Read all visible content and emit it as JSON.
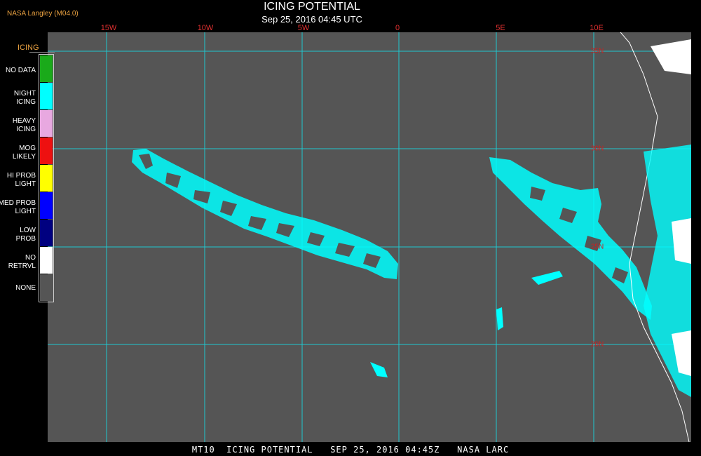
{
  "provider": "NASA Langley (M04.0)",
  "title": "ICING POTENTIAL",
  "subtitle": "Sep 25, 2016 04:45 UTC",
  "footer": "MT10  ICING POTENTIAL   SEP 25, 2016 04:45Z   NASA LARC",
  "longitude_labels": [
    "15W",
    "10W",
    "5W",
    "0",
    "5E",
    "10E"
  ],
  "latitude_labels": [
    "35N",
    "30N",
    "25N",
    "20N"
  ],
  "legend": {
    "title": "ICING",
    "items": [
      {
        "label": "NO DATA",
        "color": "#1aaa1a"
      },
      {
        "label": "NIGHT\nICING",
        "color": "#00ffff"
      },
      {
        "label": "HEAVY\nICING",
        "color": "#e8a8e0"
      },
      {
        "label": "MOG\nLIKELY",
        "color": "#ee1010"
      },
      {
        "label": "HI PROB\nLIGHT",
        "color": "#ffff00"
      },
      {
        "label": "MED PROB\nLIGHT",
        "color": "#0000ff"
      },
      {
        "label": "LOW\nPROB",
        "color": "#000080"
      },
      {
        "label": "NO\nRETRVL",
        "color": "#ffffff"
      },
      {
        "label": "NONE",
        "color": "#555555"
      }
    ]
  },
  "colors": {
    "background": "#555555",
    "grid": "#20c8d0",
    "icing": "#00ffff",
    "coast": "#ffffff"
  }
}
